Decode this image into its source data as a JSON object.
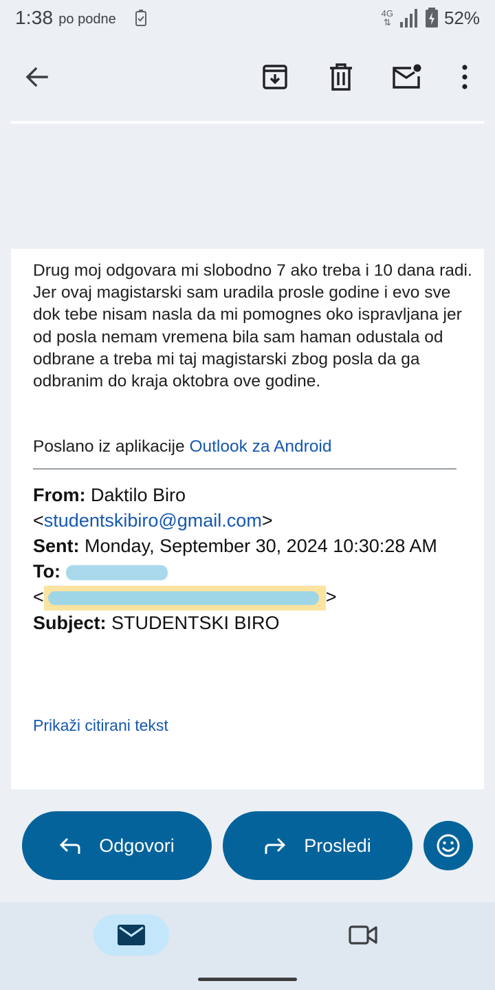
{
  "status_bar": {
    "time": "1:38",
    "time_suffix": "po podne",
    "network": "4G",
    "battery": "52%"
  },
  "toolbar": {
    "back_icon": "arrow-back-icon",
    "archive_icon": "archive-icon",
    "delete_icon": "trash-icon",
    "mark_unread_icon": "mail-unread-icon",
    "more_icon": "more-vert-icon"
  },
  "message": {
    "body": "Drug moj odgovara mi slobodno 7 ako treba i 10 dana radi. Jer ovaj magistarski sam uradila prosle godine i evo sve dok tebe nisam nasla da mi pomognes oko ispravljana jer od posla nemam vremena bila sam haman odustala od odbrane a treba mi taj magistarski zbog posla da ga odbranim do kraja oktobra ove godine.",
    "sent_from_prefix": "Poslano iz aplikacije",
    "sent_from_link": "Outlook za Android",
    "quoted": {
      "from_label": "From:",
      "from_name": "Daktilo Biro",
      "from_email": "studentskibiro@gmail.com",
      "sent_label": "Sent:",
      "sent_value": "Monday, September 30, 2024 10:30:28 AM",
      "to_label": "To:",
      "subject_label": "Subject:",
      "subject_value": "STUDENTSKI BIRO",
      "lt": "<",
      "gt": ">"
    },
    "show_quoted": "Prikaži citirani tekst"
  },
  "actions": {
    "reply": "Odgovori",
    "forward": "Prosledi",
    "emoji_icon": "emoji-reaction-icon"
  },
  "bottom_nav": {
    "mail_icon": "mail-icon",
    "meet_icon": "video-camera-icon"
  },
  "colors": {
    "accent": "#04639b",
    "link": "#1558b0",
    "nav_selected": "#c4e6fb",
    "background": "#ecf0f5"
  }
}
